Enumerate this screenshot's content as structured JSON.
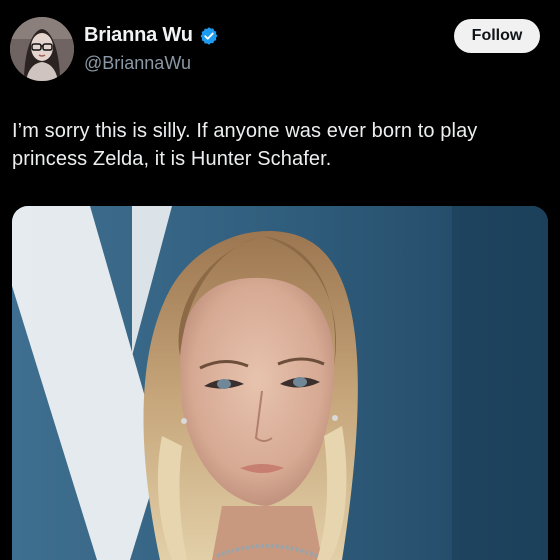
{
  "author": {
    "display_name": "Brianna Wu",
    "handle": "@BriannaWu",
    "verified": true,
    "avatar_icon": "profile-photo"
  },
  "actions": {
    "follow_label": "Follow"
  },
  "tweet": {
    "text": "I’m sorry this is silly. If anyone was ever born to play princess Zelda, it is Hunter Schafer."
  },
  "media": {
    "kind": "photo",
    "icon": "photo-portrait"
  },
  "colors": {
    "background": "#000000",
    "verified_badge": "#1d9bf0",
    "follow_button_bg": "#f1f1f1",
    "handle_text": "#8b98a5"
  }
}
